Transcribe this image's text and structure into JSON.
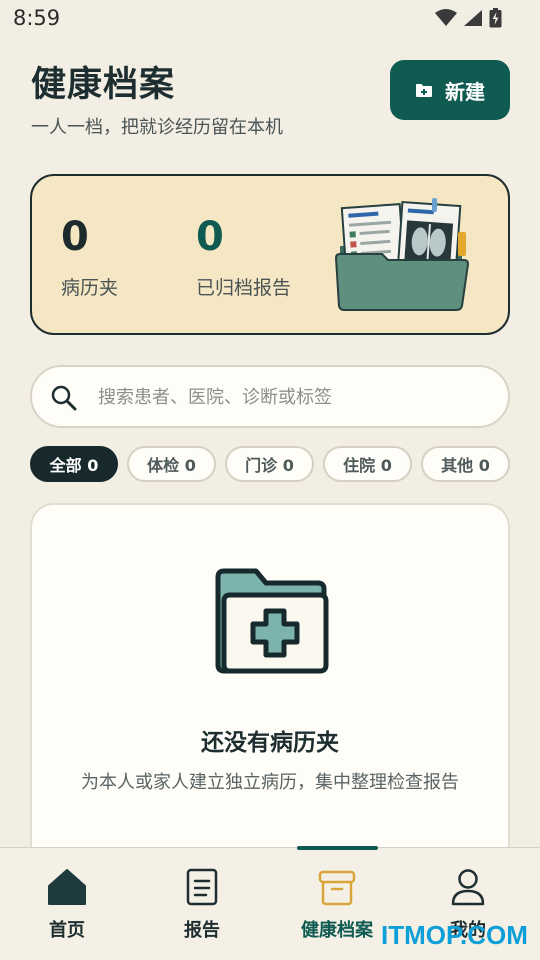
{
  "status_bar": {
    "time": "8:59"
  },
  "header": {
    "title": "健康档案",
    "subtitle": "一人一档，把就诊经历留在本机",
    "new_button_label": "新建"
  },
  "summary": {
    "folders_count": "0",
    "folders_label": "病历夹",
    "archived_count": "0",
    "archived_label": "已归档报告"
  },
  "search": {
    "placeholder": "搜索患者、医院、诊断或标签"
  },
  "filters": [
    {
      "label": "全部 0",
      "active": true
    },
    {
      "label": "体检 0",
      "active": false
    },
    {
      "label": "门诊 0",
      "active": false
    },
    {
      "label": "住院 0",
      "active": false
    },
    {
      "label": "其他 0",
      "active": false
    }
  ],
  "empty_state": {
    "title": "还没有病历夹",
    "description": "为本人或家人建立独立病历，集中整理检查报告"
  },
  "bottom_nav": [
    {
      "label": "首页",
      "icon": "home-icon",
      "active": false
    },
    {
      "label": "报告",
      "icon": "document-icon",
      "active": false
    },
    {
      "label": "健康档案",
      "icon": "archive-box-icon",
      "active": true
    },
    {
      "label": "我的",
      "icon": "user-icon",
      "active": false
    }
  ],
  "watermark": "ITMOP.COM",
  "colors": {
    "primary": "#0f5b52",
    "background": "#f2eee4",
    "summary_card": "#f6e7c4",
    "active_chip": "#17292c",
    "active_nav": "#d9a53a",
    "watermark": "#0e9fd8"
  }
}
